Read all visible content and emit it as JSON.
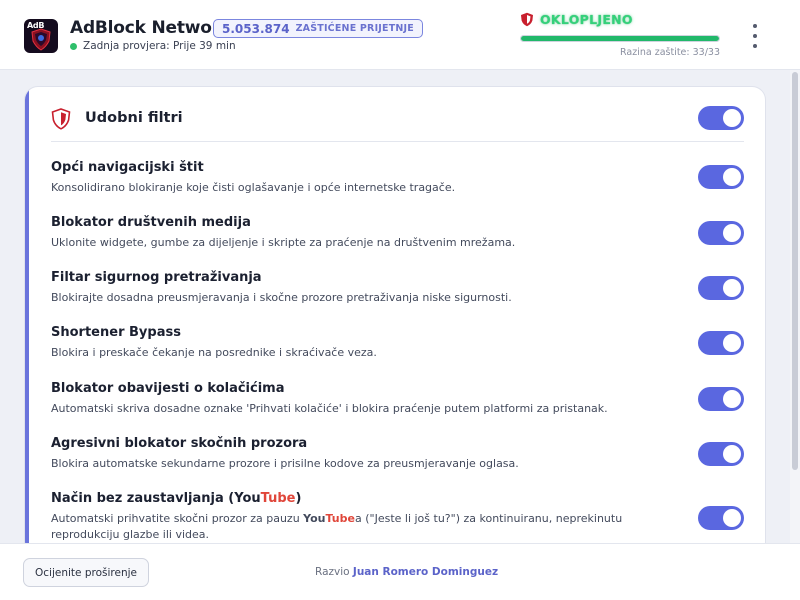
{
  "header": {
    "logo_text": "AdB",
    "app_title": "AdBlock Network",
    "blocked_count": "5.053.874",
    "blocked_label": "ZAŠTIĆENE PRIJETNJE",
    "last_check": "Zadnja provjera: Prije 39 min",
    "status_text": "OKLOPLJENO",
    "protection_level": 1.0,
    "protection_label": "Razina zaštite: 33/33"
  },
  "card": {
    "title": "Udobni filtri",
    "master_toggle_on": true,
    "filters": [
      {
        "title": "Opći navigacijski štit",
        "desc": "Konsolidirano blokiranje koje čisti oglašavanje i opće internetske tragače.",
        "enabled": true
      },
      {
        "title": "Blokator društvenih medija",
        "desc": "Uklonite widgete, gumbe za dijeljenje i skripte za praćenje na društvenim mrežama.",
        "enabled": true
      },
      {
        "title": "Filtar sigurnog pretraživanja",
        "desc": "Blokirajte dosadna preusmjeravanja i skočne prozore pretraživanja niske sigurnosti.",
        "enabled": true
      },
      {
        "title": "Shortener Bypass",
        "desc": "Blokira i preskače čekanje na posrednike i skraćivače veza.",
        "enabled": true
      },
      {
        "title": "Blokator obavijesti o kolačićima",
        "desc": "Automatski skriva dosadne oznake 'Prihvati kolačiće' i blokira praćenje putem platformi za pristanak.",
        "enabled": true
      },
      {
        "title": "Agresivni blokator skočnih prozora",
        "desc": "Blokira automatske sekundarne prozore i prisilne kodove za preusmjeravanje oglasa.",
        "enabled": true
      },
      {
        "title_prefix": "Način bez zaustavljanja (",
        "title_you": "You",
        "title_tube": "Tube",
        "title_suffix": ")",
        "desc_prefix": "Automatski prihvatite skočni prozor za pauzu ",
        "desc_you": "You",
        "desc_tube": "Tube",
        "desc_suffix": "a (\"Jeste li još tu?\") za kontinuiranu, neprekinutu reprodukciju glazbe ili videa.",
        "enabled": true
      }
    ]
  },
  "footer": {
    "rate_button": "Ocijenite proširenje",
    "credit_prefix": "Razvio ",
    "credit_author": "Juan Romero Dominguez"
  },
  "colors": {
    "accent": "#5a67e0",
    "status_green": "#33d17a",
    "youtube_red": "#e0463a"
  },
  "icons": {
    "status": "shield-icon",
    "card": "shield-icon",
    "menu": "more-vertical-icon"
  }
}
